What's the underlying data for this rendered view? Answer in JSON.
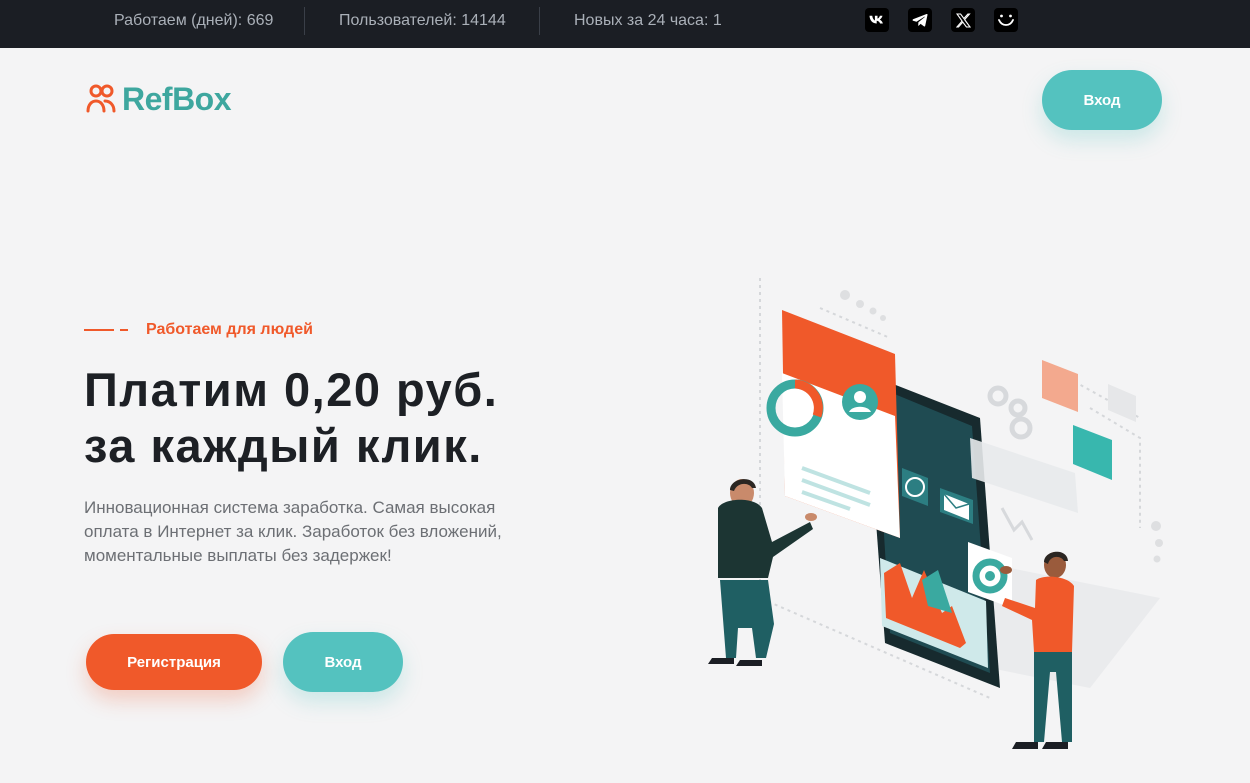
{
  "topbar": {
    "stats": [
      {
        "label": "Работаем (дней): 669"
      },
      {
        "label": "Пользователей: 14144"
      },
      {
        "label": "Новых за 24 часа: 1"
      }
    ],
    "socials": [
      {
        "icon": "vk-icon"
      },
      {
        "icon": "telegram-icon"
      },
      {
        "icon": "x-icon"
      },
      {
        "icon": "smile-icon"
      }
    ]
  },
  "header": {
    "logo_text": "RefBox",
    "login_label": "Вход"
  },
  "hero": {
    "tagline": "Работаем для людей",
    "title_line1": "Платим 0,20 руб.",
    "title_line2": "за каждый клик.",
    "description": "Инновационная система заработка. Самая высокая оплата в Интернет за клик. Заработок без вложений, моментальные выплаты без задержек!",
    "register_label": "Регистрация",
    "login_label": "Вход"
  },
  "colors": {
    "accent_orange": "#f0592a",
    "accent_teal": "#54c2bf",
    "logo_teal": "#3ea79f",
    "topbar_bg": "#1b1e24"
  }
}
